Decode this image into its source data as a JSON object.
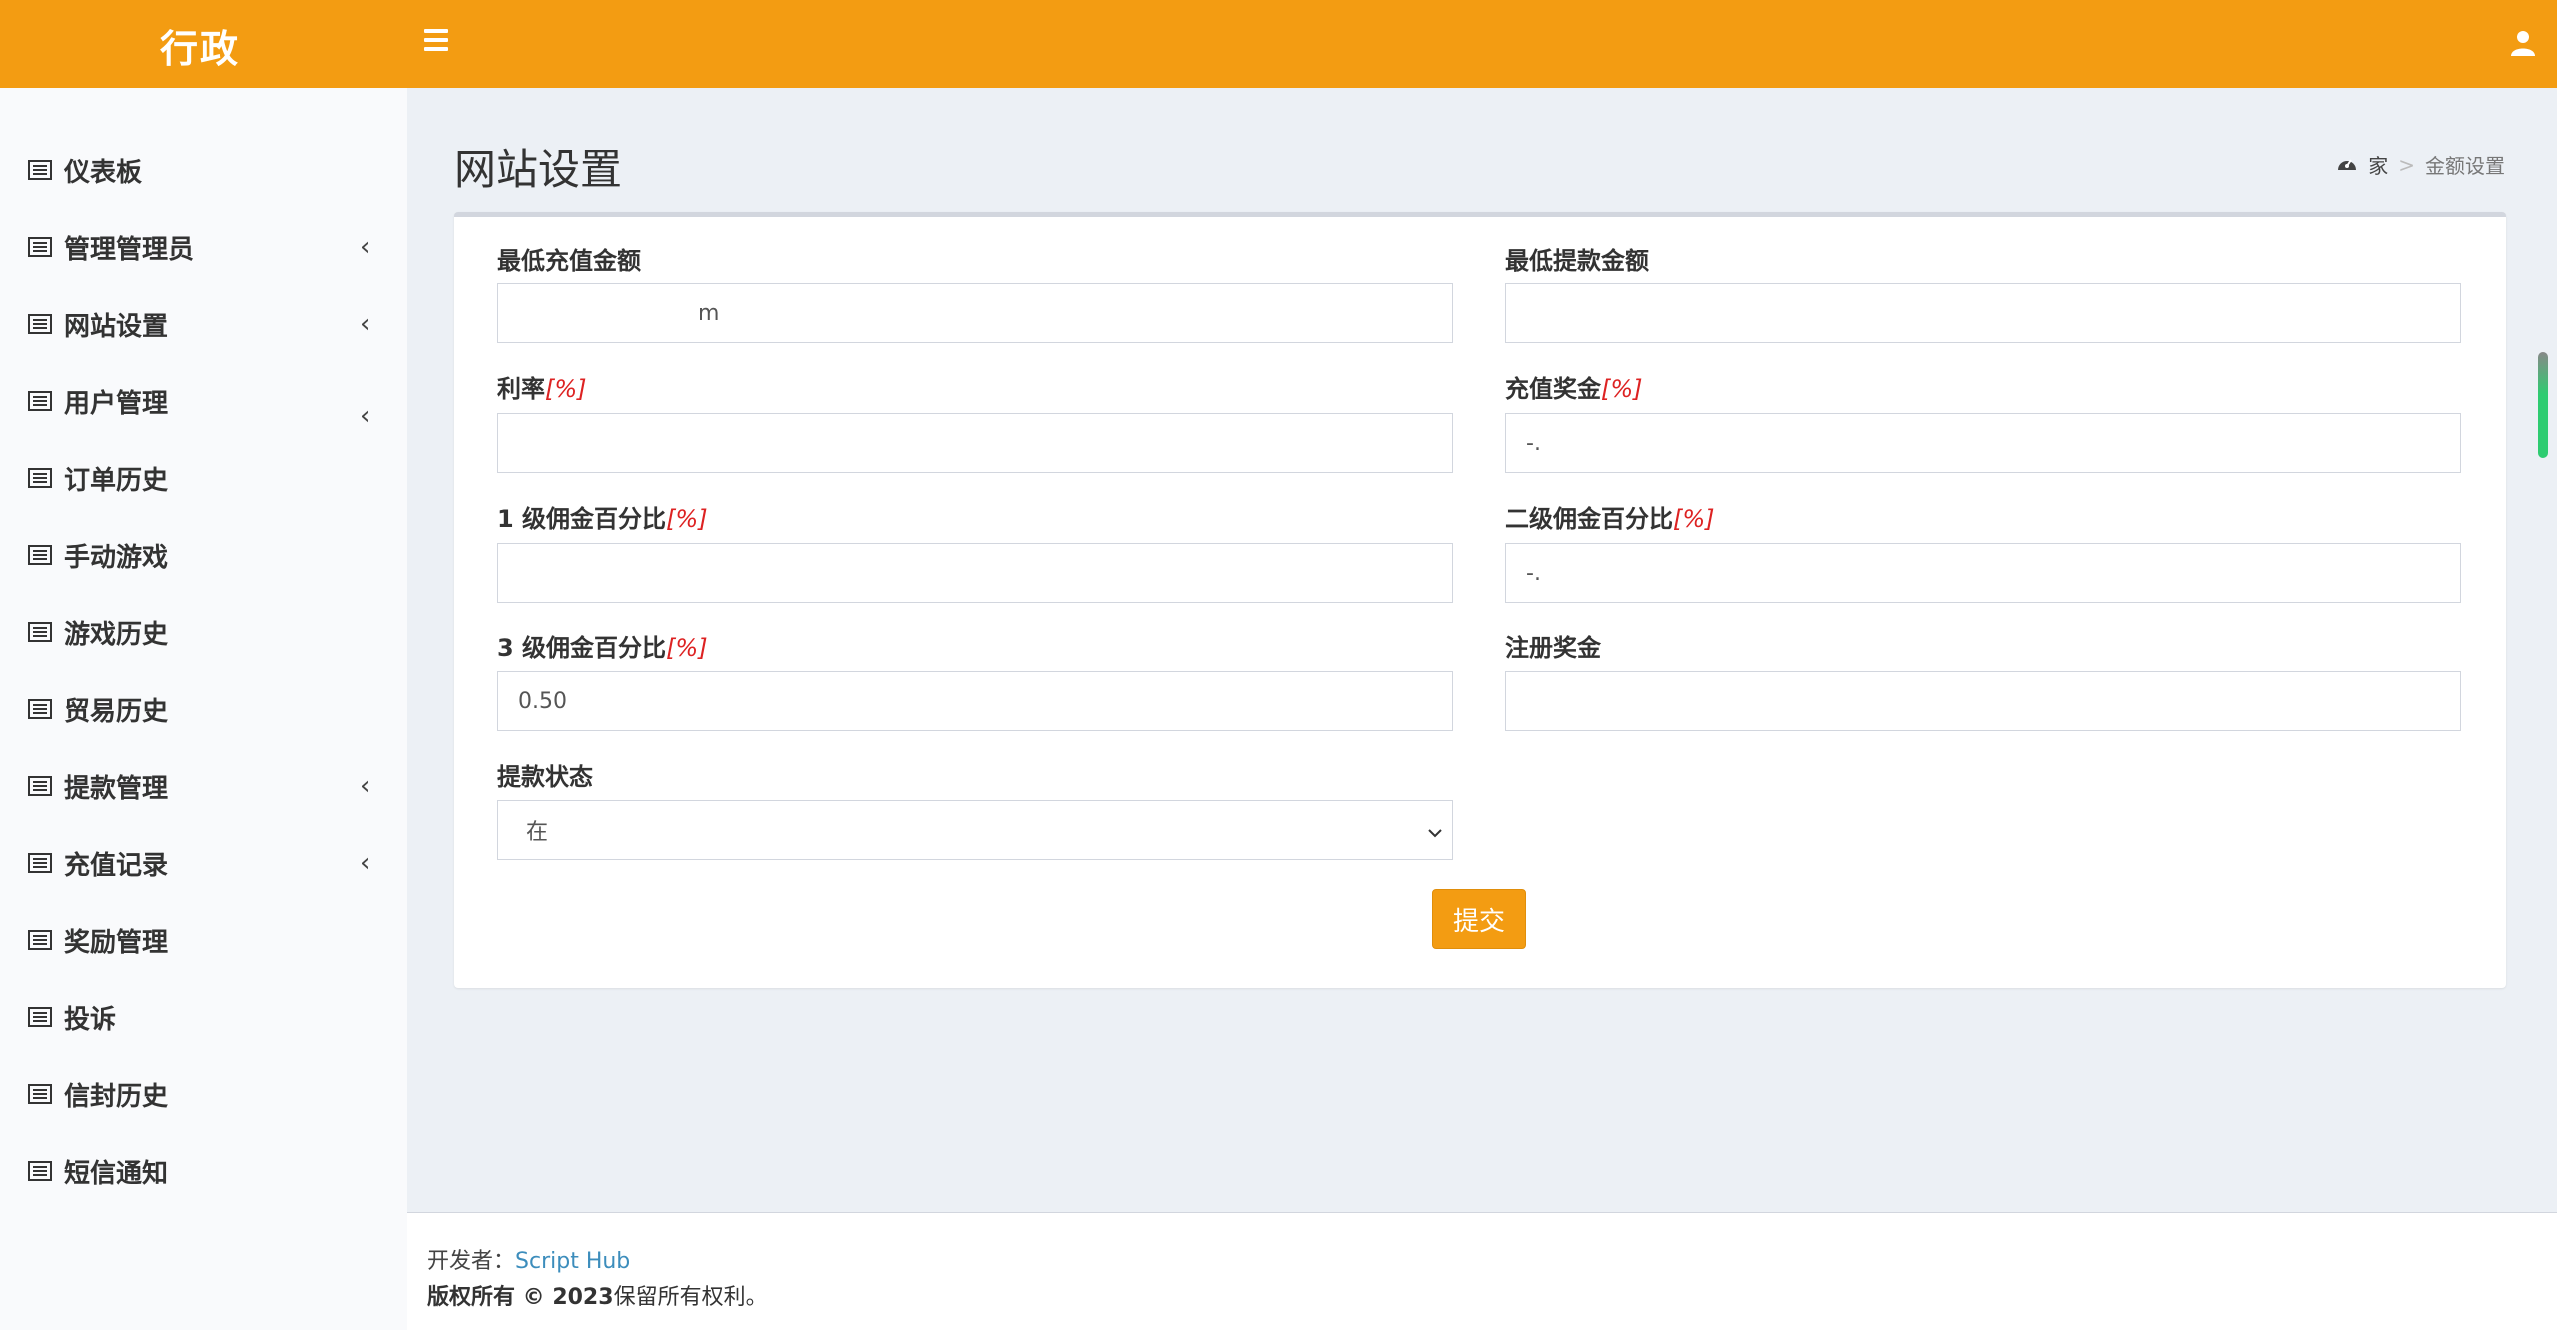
{
  "header": {
    "logo_text": "行政",
    "menu_icon": "hamburger-icon",
    "user_icon": "user-icon",
    "bar_color": "#f39c12"
  },
  "sidebar": {
    "items": [
      {
        "label": "仪表板",
        "icon": "list-icon",
        "has_chevron": false
      },
      {
        "label": "管理管理员",
        "icon": "list-icon",
        "has_chevron": true
      },
      {
        "label": "网站设置",
        "icon": "list-icon",
        "has_chevron": true
      },
      {
        "label": "用户管理",
        "icon": "list-icon",
        "has_chevron": true
      },
      {
        "label": "订单历史",
        "icon": "list-icon",
        "has_chevron": false
      },
      {
        "label": "手动游戏",
        "icon": "list-icon",
        "has_chevron": false
      },
      {
        "label": "游戏历史",
        "icon": "list-icon",
        "has_chevron": false
      },
      {
        "label": "贸易历史",
        "icon": "list-icon",
        "has_chevron": false
      },
      {
        "label": "提款管理",
        "icon": "list-icon",
        "has_chevron": true
      },
      {
        "label": "充值记录",
        "icon": "list-icon",
        "has_chevron": true
      },
      {
        "label": "奖励管理",
        "icon": "list-icon",
        "has_chevron": false
      },
      {
        "label": "投诉",
        "icon": "list-icon",
        "has_chevron": false
      },
      {
        "label": "信封历史",
        "icon": "list-icon",
        "has_chevron": false
      },
      {
        "label": "短信通知",
        "icon": "list-icon",
        "has_chevron": false
      }
    ],
    "chevron_glyph": "‹"
  },
  "page": {
    "title": "网站设置",
    "breadcrumb": {
      "home": "家",
      "separator": ">",
      "current": "金额设置"
    }
  },
  "form": {
    "min_recharge": {
      "label": "最低充值金额",
      "value": "m"
    },
    "min_withdraw": {
      "label": "最低提款金额",
      "value": ""
    },
    "interest_rate": {
      "label": "利率",
      "unit": "[%]",
      "value": ""
    },
    "recharge_bonus": {
      "label": "充值奖金",
      "unit": "[%]",
      "value": "-."
    },
    "level1_commission": {
      "label": "1 级佣金百分比",
      "unit": "[%]",
      "value": ""
    },
    "level2_commission": {
      "label": "二级佣金百分比",
      "unit": "[%]",
      "value": "-."
    },
    "level3_commission": {
      "label": "3 级佣金百分比",
      "unit": "[%]",
      "value": "0.50"
    },
    "register_bonus": {
      "label": "注册奖金",
      "value": ""
    },
    "withdraw_status": {
      "label": "提款状态",
      "selected": "在"
    },
    "submit_label": "提交"
  },
  "footer": {
    "developer_prefix": "开发者：",
    "developer_name": "Script Hub",
    "copyright_bold": "版权所有 © 2023",
    "copyright_rest": "保留所有权利。"
  },
  "colors": {
    "accent": "#f39c12",
    "link": "#3c8dbc",
    "unit_red": "#dd2222",
    "content_bg": "#ecf0f5"
  }
}
